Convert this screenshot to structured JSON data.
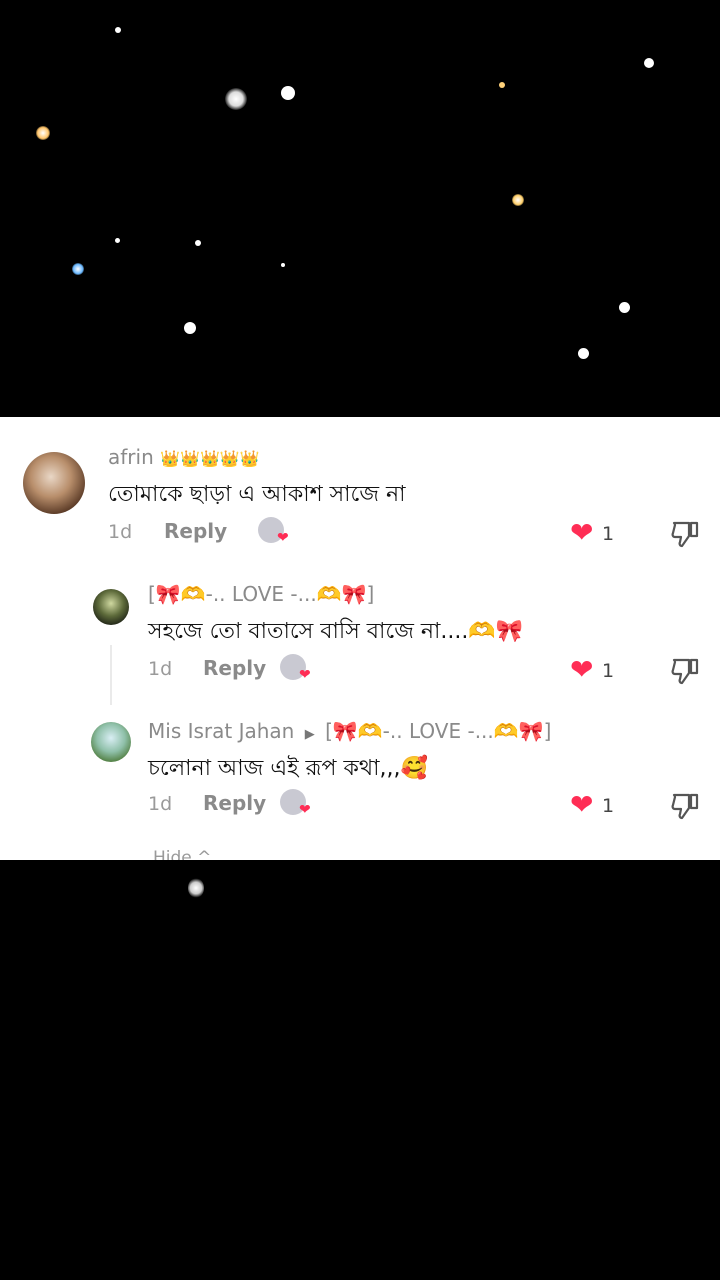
{
  "comments": [
    {
      "username": "afrin",
      "crowns": "👑👑👑👑👑",
      "text": "তোমাকে ছাড়া এ আকাশ সাজে না",
      "time": "1d",
      "reply_label": "Reply",
      "likes": "1"
    },
    {
      "username": "[🎀🫶-.. LOVE -...🫶🎀]",
      "text": "সহজে তো বাতাসে বাসি বাজে না....🫶🎀",
      "time": "1d",
      "reply_label": "Reply",
      "likes": "1"
    },
    {
      "username": "Mis Israt Jahan",
      "reply_to": "[🎀🫶-.. LOVE -...🫶🎀]",
      "text": "চলোনা আজ এই রূপ কথা,,,🥰",
      "time": "1d",
      "reply_label": "Reply",
      "likes": "1"
    }
  ],
  "hide_label": "Hide ^",
  "colors": {
    "heart": "#ff2d55",
    "meta": "#9a9a9a",
    "background": "#000000",
    "panel": "#ffffff"
  },
  "icons": [
    "heart-icon",
    "dislike-icon",
    "reply-arrow-icon"
  ]
}
